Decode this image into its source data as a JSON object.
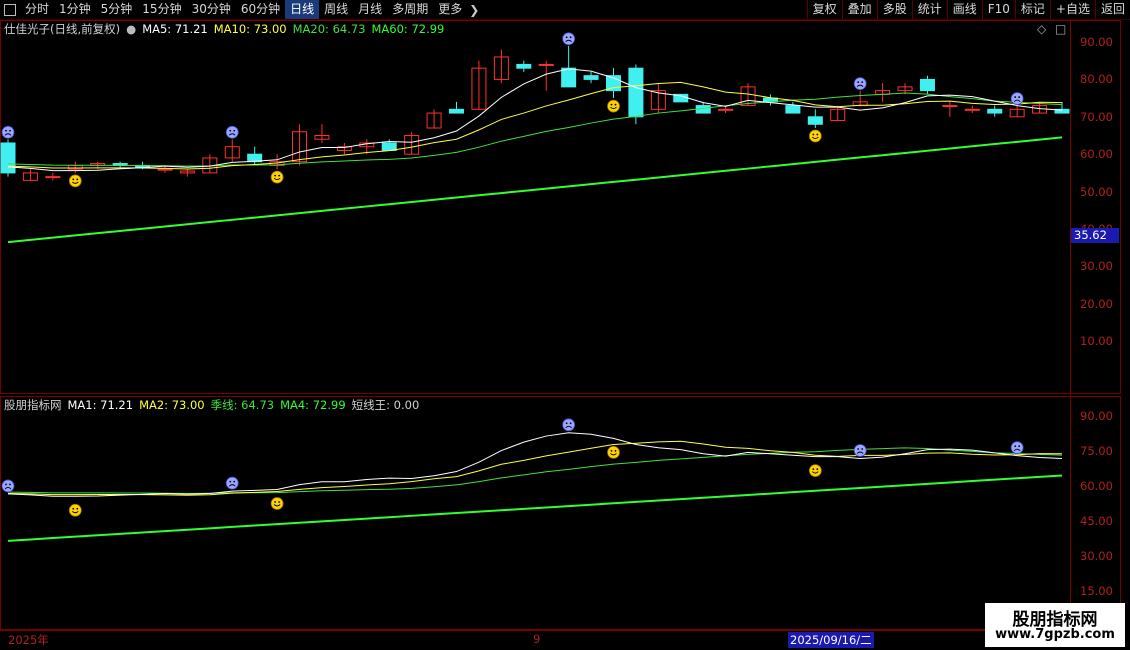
{
  "toolbar": {
    "left_items": [
      "分时",
      "1分钟",
      "5分钟",
      "15分钟",
      "30分钟",
      "60分钟",
      "日线",
      "周线",
      "月线",
      "多周期",
      "更多"
    ],
    "active_index": 6,
    "right_items": [
      "复权",
      "叠加",
      "多股",
      "统计",
      "画线",
      "F10",
      "标记",
      "+自选",
      "返回"
    ]
  },
  "main_legend": {
    "title": "仕佳光子(日线,前复权)",
    "ma5": "MA5: 71.21",
    "ma10": "MA10: 73.00",
    "ma20": "MA20: 64.73",
    "ma60": "MA60: 72.99"
  },
  "sub_legend": {
    "title": "股朋指标网",
    "ma1": "MA1: 71.21",
    "ma2": "MA2: 73.00",
    "season": "季线: 64.73",
    "ma4": "MA4: 72.99",
    "short_king": "短线王: 0.00"
  },
  "main_axis": [
    "90.00",
    "80.00",
    "70.00",
    "60.00",
    "50.00",
    "40.00",
    "30.00",
    "20.00",
    "10.00"
  ],
  "current_price": "35.62",
  "sub_axis": [
    "90.00",
    "75.00",
    "60.00",
    "45.00",
    "30.00",
    "15.00"
  ],
  "dates": {
    "start": "2025年",
    "mid": "9",
    "selected": "2025/09/16/二"
  },
  "watermark": {
    "line1": "股朋指标网",
    "line2": "www.7gpzb.com"
  },
  "colors": {
    "up": "#ff3030",
    "down": "#40f0f0",
    "ma5": "#ffffff",
    "ma10": "#ffff40",
    "ma20": "#40e040",
    "ma60": "#30ff30",
    "axis": "#b02020"
  },
  "chart_data": {
    "type": "candlestick",
    "ylim": [
      10,
      90
    ],
    "candles": [
      {
        "o": 63,
        "h": 64,
        "l": 54,
        "c": 55
      },
      {
        "o": 53,
        "h": 56,
        "l": 53,
        "c": 55
      },
      {
        "o": 54,
        "h": 55,
        "l": 53,
        "c": 54
      },
      {
        "o": 56,
        "h": 58,
        "l": 55,
        "c": 57
      },
      {
        "o": 57,
        "h": 58,
        "l": 56,
        "c": 57.5
      },
      {
        "o": 57.5,
        "h": 58,
        "l": 56,
        "c": 57
      },
      {
        "o": 57,
        "h": 58,
        "l": 56,
        "c": 56.5
      },
      {
        "o": 56,
        "h": 57,
        "l": 55,
        "c": 56
      },
      {
        "o": 55,
        "h": 56,
        "l": 54,
        "c": 55.5
      },
      {
        "o": 55,
        "h": 60,
        "l": 55,
        "c": 59
      },
      {
        "o": 59,
        "h": 64,
        "l": 58,
        "c": 62
      },
      {
        "o": 60,
        "h": 62,
        "l": 57,
        "c": 58
      },
      {
        "o": 57,
        "h": 60,
        "l": 56,
        "c": 58
      },
      {
        "o": 58,
        "h": 68,
        "l": 57,
        "c": 66
      },
      {
        "o": 64,
        "h": 68,
        "l": 63,
        "c": 65
      },
      {
        "o": 61,
        "h": 63,
        "l": 60,
        "c": 62
      },
      {
        "o": 62,
        "h": 64,
        "l": 60,
        "c": 63
      },
      {
        "o": 63,
        "h": 64,
        "l": 61,
        "c": 61
      },
      {
        "o": 60,
        "h": 66,
        "l": 60,
        "c": 65
      },
      {
        "o": 67,
        "h": 72,
        "l": 67,
        "c": 71
      },
      {
        "o": 72,
        "h": 74,
        "l": 71,
        "c": 71
      },
      {
        "o": 72,
        "h": 85,
        "l": 72,
        "c": 83
      },
      {
        "o": 80,
        "h": 88,
        "l": 79,
        "c": 86
      },
      {
        "o": 84,
        "h": 85,
        "l": 82,
        "c": 83
      },
      {
        "o": 84,
        "h": 85,
        "l": 77,
        "c": 84
      },
      {
        "o": 83,
        "h": 89,
        "l": 78,
        "c": 78
      },
      {
        "o": 81,
        "h": 82,
        "l": 79,
        "c": 80
      },
      {
        "o": 81,
        "h": 83,
        "l": 75,
        "c": 77
      },
      {
        "o": 83,
        "h": 84,
        "l": 68,
        "c": 70
      },
      {
        "o": 72,
        "h": 79,
        "l": 71,
        "c": 77
      },
      {
        "o": 76,
        "h": 76,
        "l": 74,
        "c": 74
      },
      {
        "o": 73,
        "h": 74,
        "l": 71,
        "c": 71
      },
      {
        "o": 72,
        "h": 73,
        "l": 71,
        "c": 72
      },
      {
        "o": 73,
        "h": 79,
        "l": 73,
        "c": 78
      },
      {
        "o": 75,
        "h": 76,
        "l": 73,
        "c": 74
      },
      {
        "o": 73,
        "h": 74,
        "l": 71,
        "c": 71
      },
      {
        "o": 70,
        "h": 72,
        "l": 67,
        "c": 68
      },
      {
        "o": 69,
        "h": 73,
        "l": 69,
        "c": 72
      },
      {
        "o": 73,
        "h": 77,
        "l": 73,
        "c": 74
      },
      {
        "o": 76,
        "h": 79,
        "l": 74,
        "c": 77
      },
      {
        "o": 77,
        "h": 79,
        "l": 76,
        "c": 78
      },
      {
        "o": 80,
        "h": 81,
        "l": 76,
        "c": 77
      },
      {
        "o": 73,
        "h": 74,
        "l": 70,
        "c": 73
      },
      {
        "o": 72,
        "h": 73,
        "l": 71,
        "c": 72
      },
      {
        "o": 72,
        "h": 73,
        "l": 70,
        "c": 71
      },
      {
        "o": 70,
        "h": 73,
        "l": 70,
        "c": 72
      },
      {
        "o": 71,
        "h": 74,
        "l": 71,
        "c": 73
      },
      {
        "o": 72,
        "h": 74,
        "l": 71,
        "c": 71
      }
    ]
  }
}
